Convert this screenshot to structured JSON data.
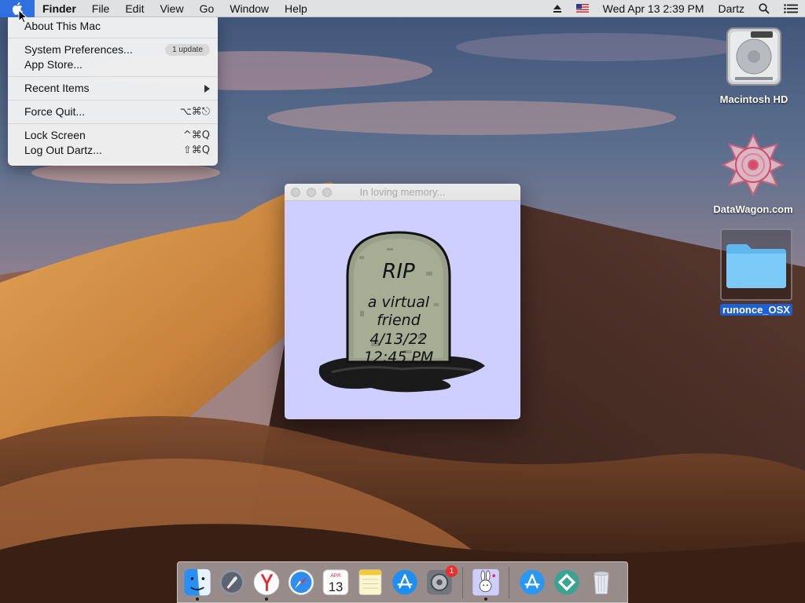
{
  "menubar": {
    "app_name": "Finder",
    "menus": [
      "File",
      "Edit",
      "View",
      "Go",
      "Window",
      "Help"
    ],
    "datetime": "Wed Apr 13  2:39 PM",
    "user": "Dartz",
    "status_icons": [
      "eject-icon",
      "us-flag-icon",
      "spotlight-icon",
      "notification-center-icon"
    ]
  },
  "apple_menu": {
    "about": "About This Mac",
    "system_preferences": "System Preferences...",
    "update_badge": "1 update",
    "app_store": "App Store...",
    "recent_items": "Recent Items",
    "force_quit": "Force Quit...",
    "force_quit_shortcut": "⌥⌘⎋",
    "lock_screen": "Lock Screen",
    "lock_screen_shortcut": "^⌘Q",
    "log_out": "Log Out Dartz...",
    "log_out_shortcut": "⇧⌘Q"
  },
  "desktop_icons": {
    "hd": "Macintosh HD",
    "datawagon": "DataWagon.com",
    "folder": "runonce_OSX"
  },
  "window": {
    "title": "In loving memory...",
    "background": "#cfcfff",
    "tombstone": {
      "line1": "RIP",
      "line2": "a virtual",
      "line3": "friend",
      "line4": "4/13/22",
      "line5": "12:45 PM"
    }
  },
  "dock": {
    "apps": [
      "finder-icon",
      "launchpad-icon",
      "yandex-browser-icon",
      "safari-icon",
      "calendar-icon",
      "notes-icon",
      "app-store-icon",
      "system-preferences-icon",
      "bunny-app-icon",
      "app-store-download-icon",
      "mint-app-icon",
      "trash-icon"
    ],
    "calendar_month": "APR",
    "calendar_day": "13",
    "system_prefs_badge": "1"
  },
  "colors": {
    "menu_highlight": "#2f6fe0",
    "selection": "#1e5fd1",
    "window_bg": "#cfcfff"
  }
}
